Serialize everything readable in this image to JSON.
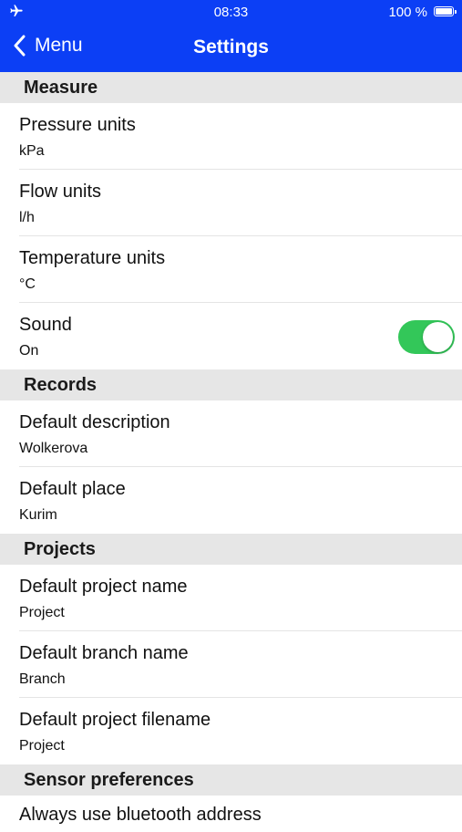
{
  "status_bar": {
    "time": "08:33",
    "battery_label": "100 %",
    "icon": "airplane-icon"
  },
  "nav": {
    "back_label": "Menu",
    "title": "Settings"
  },
  "sections": [
    {
      "title": "Measure",
      "rows": [
        {
          "label": "Pressure units",
          "value": "kPa"
        },
        {
          "label": "Flow units",
          "value": "l/h"
        },
        {
          "label": "Temperature units",
          "value": "°C"
        },
        {
          "label": "Sound",
          "value": "On",
          "toggle": true
        }
      ]
    },
    {
      "title": "Records",
      "rows": [
        {
          "label": "Default description",
          "value": "Wolkerova"
        },
        {
          "label": "Default place",
          "value": "Kurim"
        }
      ]
    },
    {
      "title": "Projects",
      "rows": [
        {
          "label": "Default project name",
          "value": "Project"
        },
        {
          "label": "Default branch name",
          "value": "Branch"
        },
        {
          "label": "Default project filename",
          "value": "Project"
        }
      ]
    },
    {
      "title": "Sensor preferences",
      "rows": [
        {
          "label": "Always use bluetooth address"
        }
      ]
    }
  ],
  "colors": {
    "nav_background": "#0c3ff5",
    "toggle_on": "#33c759",
    "section_background": "#e6e6e6"
  }
}
